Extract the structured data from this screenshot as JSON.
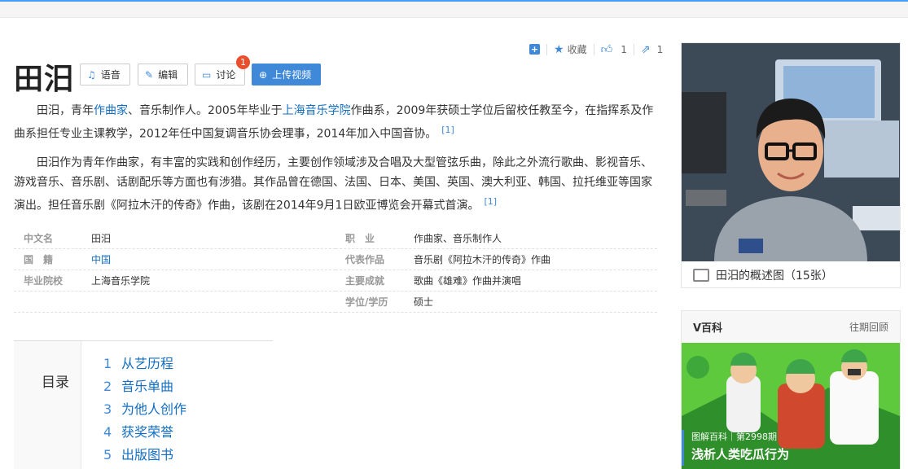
{
  "title": "田汨",
  "toolbar": {
    "plus_icon": "+",
    "collect_label": "收藏",
    "like_count": "1",
    "share_count": "1"
  },
  "buttons": {
    "audio": "语音",
    "edit": "编辑",
    "discuss": "讨论",
    "discuss_badge": "1",
    "upload": "上传视频"
  },
  "intro": {
    "p1_a": "田汨，青年",
    "p1_link1": "作曲家",
    "p1_b": "、音乐制作人。2005年毕业于",
    "p1_link2": "上海音乐学院",
    "p1_c": "作曲系，2009年获硕士学位后留校任教至今，在指挥系及作曲系担任专业主课教学，2012年任中国复调音乐协会理事，2014年加入中国音协。",
    "p1_ref": "[1]",
    "p2": "田汨作为青年作曲家，有丰富的实践和创作经历，主要创作领域涉及合唱及大型管弦乐曲，除此之外流行歌曲、影视音乐、游戏音乐、音乐剧、话剧配乐等方面也有涉猎。其作品曾在德国、法国、日本、美国、英国、澳大利亚、韩国、拉托维亚等国家演出。担任音乐剧《阿拉木汗的传奇》作曲，该剧在2014年9月1日欧亚博览会开幕式首演。",
    "p2_ref": "[1]"
  },
  "info": {
    "left": [
      {
        "k": "中文名",
        "v": "田汨"
      },
      {
        "k": "国　籍",
        "v": "中国"
      },
      {
        "k": "毕业院校",
        "v": "上海音乐学院"
      }
    ],
    "right": [
      {
        "k": "职　业",
        "v": "作曲家、音乐制作人"
      },
      {
        "k": "代表作品",
        "v": "音乐剧《阿拉木汗的传奇》作曲"
      },
      {
        "k": "主要成就",
        "v": "歌曲《雄难》作曲并演唱"
      },
      {
        "k": "学位/学历",
        "v": "硕士"
      }
    ]
  },
  "toc": {
    "label": "目录",
    "items": [
      {
        "n": "1",
        "t": "从艺历程"
      },
      {
        "n": "2",
        "t": "音乐单曲"
      },
      {
        "n": "3",
        "t": "为他人创作"
      },
      {
        "n": "4",
        "t": "获奖荣誉"
      },
      {
        "n": "5",
        "t": "出版图书"
      }
    ]
  },
  "side": {
    "photo_caption": "田汨的概述图（15张）"
  },
  "vbaike": {
    "title": "V百科",
    "more": "往期回顾",
    "sub": "图解百科｜第2998期",
    "headline": "浅析人类吃瓜行为"
  },
  "colors": {
    "accent": "#3f89d8",
    "link": "#136ec2",
    "badge": "#e94f2c"
  }
}
